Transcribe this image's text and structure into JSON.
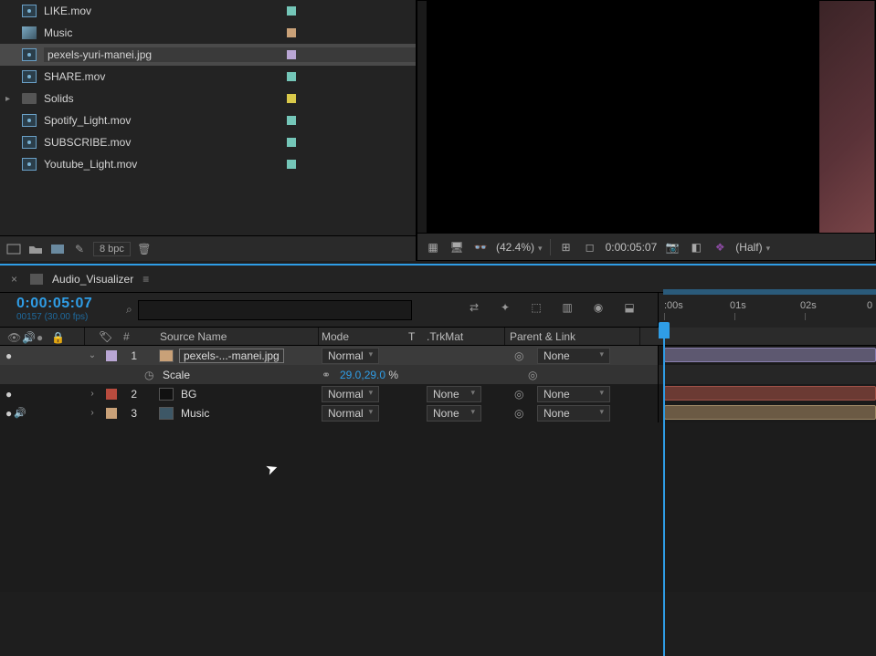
{
  "colors": {
    "teal": "#74c6b8",
    "peach": "#c9a178",
    "lavender": "#b9a6d4",
    "yellow": "#d9c94a",
    "red": "#b84b3e",
    "accent": "#2f9de6"
  },
  "project": {
    "items": [
      {
        "name": "LIKE.mov",
        "icon": "av",
        "label_color": "#74c6b8",
        "selected": false
      },
      {
        "name": "Music",
        "icon": "comp",
        "label_color": "#c9a178",
        "selected": false
      },
      {
        "name": "pexels-yuri-manei.jpg",
        "icon": "av",
        "label_color": "#b9a6d4",
        "selected": true
      },
      {
        "name": "SHARE.mov",
        "icon": "av",
        "label_color": "#74c6b8",
        "selected": false
      },
      {
        "name": "Solids",
        "icon": "folder",
        "label_color": "#d9c94a",
        "selected": false,
        "has_children": true
      },
      {
        "name": "Spotify_Light.mov",
        "icon": "av",
        "label_color": "#74c6b8",
        "selected": false
      },
      {
        "name": "SUBSCRIBE.mov",
        "icon": "av",
        "label_color": "#74c6b8",
        "selected": false
      },
      {
        "name": "Youtube_Light.mov",
        "icon": "av",
        "label_color": "#74c6b8",
        "selected": false
      }
    ],
    "bpc": "8 bpc"
  },
  "viewer": {
    "zoom": "(42.4%)",
    "timecode": "0:00:05:07",
    "resolution": "(Half)"
  },
  "timeline": {
    "tab_name": "Audio_Visualizer",
    "timecode": "0:00:05:07",
    "frames_fps": "00157 (30.00 fps)",
    "columns": {
      "index": "#",
      "source_name": "Source Name",
      "mode": "Mode",
      "t": "T",
      "trkmat": ".TrkMat",
      "parent": "Parent & Link"
    },
    "ruler": [
      ":00s",
      "01s",
      "02s",
      "0"
    ],
    "layers": [
      {
        "index": "1",
        "name": "pexels-...-manei.jpg",
        "boxed": true,
        "label_color": "#b9a6d4",
        "mode": "Normal",
        "trkmat": "",
        "parent": "None",
        "eye": true,
        "speaker": false,
        "expanded": true,
        "selected": true
      },
      {
        "index": "2",
        "name": "BG",
        "label_color": "#b84b3e",
        "mode": "Normal",
        "trkmat": "None",
        "parent": "None",
        "eye": true,
        "speaker": false
      },
      {
        "index": "3",
        "name": "Music",
        "label_color": "#c9a178",
        "mode": "Normal",
        "trkmat": "None",
        "parent": "None",
        "eye": true,
        "speaker": true
      }
    ],
    "property": {
      "name": "Scale",
      "value": "29.0,29.0",
      "unit": "%"
    }
  }
}
